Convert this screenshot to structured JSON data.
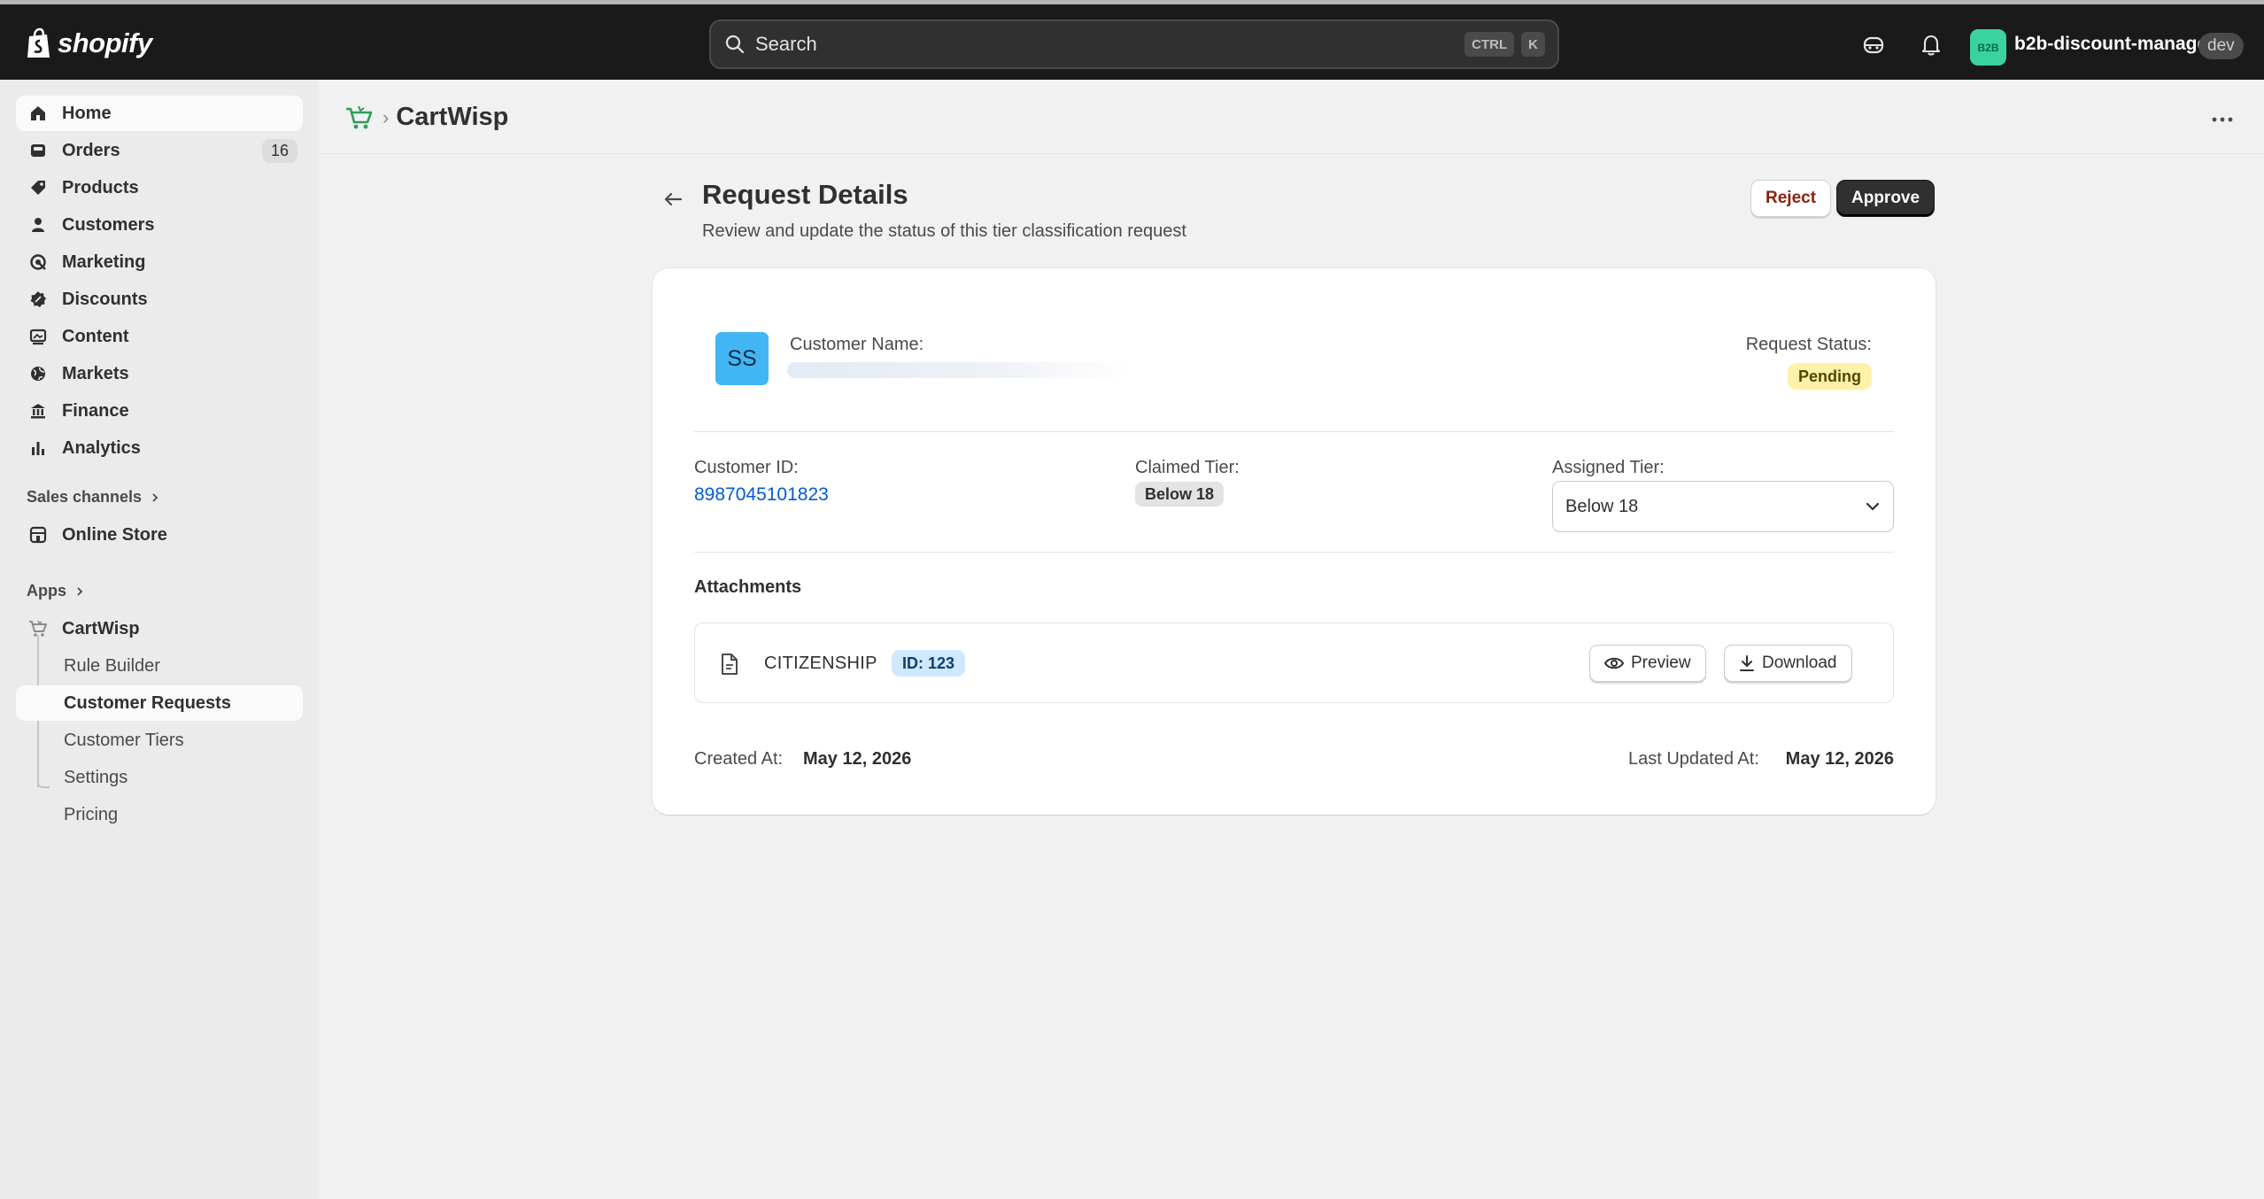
{
  "topbar": {
    "logo_text": "shopify",
    "search_placeholder": "Search",
    "shortcut_keys": [
      "CTRL",
      "K"
    ],
    "store_badge": "B2B",
    "store_name": "b2b-discount-manager",
    "env_tag": "dev",
    "brand_color": "#3ad29f"
  },
  "sidebar": {
    "items": [
      {
        "label": "Home",
        "icon": "home-icon"
      },
      {
        "label": "Orders",
        "icon": "orders-icon",
        "badge": "16"
      },
      {
        "label": "Products",
        "icon": "tag-icon"
      },
      {
        "label": "Customers",
        "icon": "person-icon"
      },
      {
        "label": "Marketing",
        "icon": "target-icon"
      },
      {
        "label": "Discounts",
        "icon": "discount-icon"
      },
      {
        "label": "Content",
        "icon": "image-icon"
      },
      {
        "label": "Markets",
        "icon": "globe-icon"
      },
      {
        "label": "Finance",
        "icon": "bank-icon"
      },
      {
        "label": "Analytics",
        "icon": "bar-chart-icon"
      }
    ],
    "sales_channels_label": "Sales channels",
    "online_store_label": "Online Store",
    "apps_label": "Apps",
    "app_name": "CartWisp",
    "app_subitems": [
      "Rule Builder",
      "Customer Requests",
      "Customer Tiers",
      "Settings",
      "Pricing"
    ],
    "active_subitem": "Customer Requests"
  },
  "app_header": {
    "title": "CartWisp"
  },
  "page": {
    "title": "Request Details",
    "subtitle": "Review and update the status of this tier classification request",
    "reject_label": "Reject",
    "approve_label": "Approve"
  },
  "request": {
    "avatar_initials": "SS",
    "customer_name_label": "Customer Name:",
    "request_status_label": "Request Status:",
    "status": "Pending",
    "customer_id_label": "Customer ID:",
    "customer_id": "8987045101823",
    "claimed_tier_label": "Claimed Tier:",
    "claimed_tier": "Below 18",
    "assigned_tier_label": "Assigned Tier:",
    "assigned_tier": "Below 18",
    "attachments_label": "Attachments",
    "attachment": {
      "name": "CITIZENSHIP",
      "id_label": "ID: 123",
      "preview_label": "Preview",
      "download_label": "Download"
    },
    "created_at_label": "Created At:",
    "created_at": "May 12, 2026",
    "updated_at_label": "Last Updated At:",
    "updated_at": "May 12, 2026"
  }
}
